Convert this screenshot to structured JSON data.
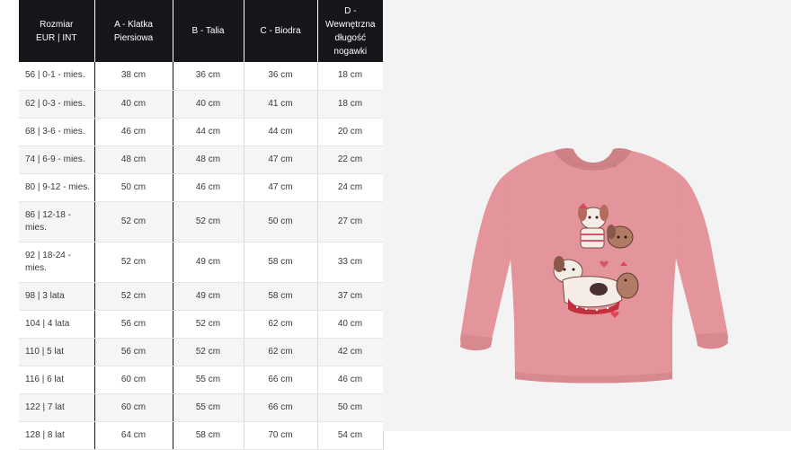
{
  "table": {
    "headers": [
      "Rozmiar\nEUR | INT",
      "A - Klatka\nPiersiowa",
      "B - Talia",
      "C - Biodra",
      "D -\nWewnętrzna\ndługość\nnogawki"
    ],
    "rows": [
      [
        "56 | 0-1 - mies.",
        "38 cm",
        "36 cm",
        "36 cm",
        "18 cm"
      ],
      [
        "62 | 0-3 - mies.",
        "40 cm",
        "40 cm",
        "41 cm",
        "18 cm"
      ],
      [
        "68 | 3-6 - mies.",
        "46 cm",
        "44 cm",
        "44 cm",
        "20 cm"
      ],
      [
        "74 | 6-9 - mies.",
        "48 cm",
        "48 cm",
        "47 cm",
        "22 cm"
      ],
      [
        "80 | 9-12 - mies.",
        "50 cm",
        "46 cm",
        "47 cm",
        "24 cm"
      ],
      [
        "86 | 12-18 -\nmies.",
        "52 cm",
        "52 cm",
        "50 cm",
        "27 cm"
      ],
      [
        "92 | 18-24 -\nmies.",
        "52 cm",
        "49 cm",
        "58 cm",
        "33 cm"
      ],
      [
        "98 | 3 lata",
        "52 cm",
        "49 cm",
        "58 cm",
        "37 cm"
      ],
      [
        "104 | 4 lata",
        "56 cm",
        "52 cm",
        "62 cm",
        "40 cm"
      ],
      [
        "110 | 5 lat",
        "56 cm",
        "52 cm",
        "62 cm",
        "42 cm"
      ],
      [
        "116 | 6 lat",
        "60 cm",
        "55 cm",
        "66 cm",
        "46 cm"
      ],
      [
        "122 | 7 lat",
        "60 cm",
        "55 cm",
        "66 cm",
        "50 cm"
      ],
      [
        "128 | 8 lat",
        "64 cm",
        "58 cm",
        "70 cm",
        "54 cm"
      ]
    ],
    "row_heights": [
      31,
      31,
      31,
      31,
      31,
      45,
      45,
      31,
      31,
      31,
      31,
      31,
      31
    ]
  },
  "colors": {
    "header_bg": "#16161a",
    "header_text": "#ffffff",
    "cell_text": "#3a3a3a",
    "panel_bg": "#f4f3f3",
    "shirt": "#e3959b"
  },
  "product": {
    "icon": "pink-long-sleeve-shirt-with-dogs-print"
  }
}
